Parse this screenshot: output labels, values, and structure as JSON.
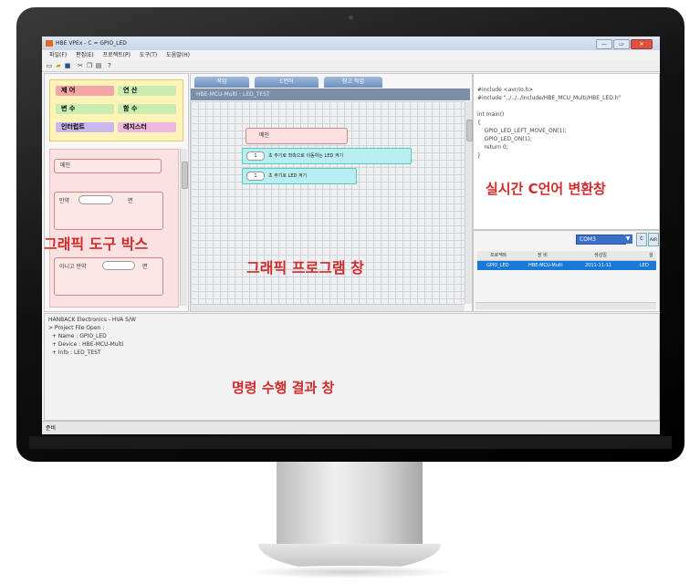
{
  "window": {
    "title": "HBE VPEx - C = GPIO_LED",
    "controls": [
      "—",
      "▭",
      "✕"
    ]
  },
  "menu": [
    "파일(F)",
    "편집(E)",
    "프로젝트(P)",
    "도구(T)",
    "도움말(H)"
  ],
  "toolbar": {
    "icons": [
      "new-file-icon",
      "open-folder-icon",
      "save-icon",
      "cut-icon",
      "copy-icon",
      "paste-icon",
      "help-icon"
    ]
  },
  "toolbox": {
    "categories": [
      {
        "label": "제     어",
        "color": "#f4a6a6"
      },
      {
        "label": "연     산",
        "color": "#c9ecb0"
      },
      {
        "label": "변     수",
        "color": "#c9ecb0"
      },
      {
        "label": "함     수",
        "color": "#c9ecb0"
      },
      {
        "label": "인터럽트",
        "color": "#c9b8f0"
      },
      {
        "label": "레지스터",
        "color": "#f0b8e0"
      }
    ],
    "blocks": [
      {
        "label": "메인"
      },
      {
        "label": "만약",
        "suffix": "면"
      },
      {
        "label": "아니고 만약",
        "suffix": "면"
      }
    ]
  },
  "program": {
    "tabs": [
      "작업",
      "C언어",
      "참고 작업"
    ],
    "path": "HBE-MCU-Multi : LED_TEST",
    "main_block": "메인",
    "blocks": [
      {
        "value": "1",
        "text": "초 주기로 좌측으로 이동하는 LED 켜기"
      },
      {
        "value": "1",
        "text": "초 주기로 LED 켜기"
      }
    ]
  },
  "code": [
    "#include <avr/io.h>",
    "#include \"../../../Include/HBE_MCU_Multi/HBE_LED.h\"",
    "",
    "int main()",
    "{",
    "    GPIO_LED_LEFT_MOVE_ON(1);",
    "    GPIO_LED_ON(1);",
    "    return 0;",
    "}"
  ],
  "project": {
    "search": "COM3",
    "headers": [
      "프로젝트",
      "장 비",
      "생성일",
      "설"
    ],
    "row": [
      "GPIO_LED",
      "HBE-MCU-Multi",
      "2011-11-11",
      "LED"
    ]
  },
  "output": [
    "HANBACK Electronics - HVA S/W",
    "> Project File Open :",
    "  + Name : GPIO_LED",
    "  + Device : HBE-MCU-Multi",
    "  + Info : LED_TEST"
  ],
  "status": "준비",
  "overlays": {
    "toolbox": "그래픽 도구 박스",
    "program": "그래픽 프로그램 창",
    "code": "실시간 C언어 변환창",
    "output": "명령 수행 결과 창"
  },
  "colors": {
    "overlay_text": "#d32a2a",
    "selected_row": "#1a78d6"
  }
}
